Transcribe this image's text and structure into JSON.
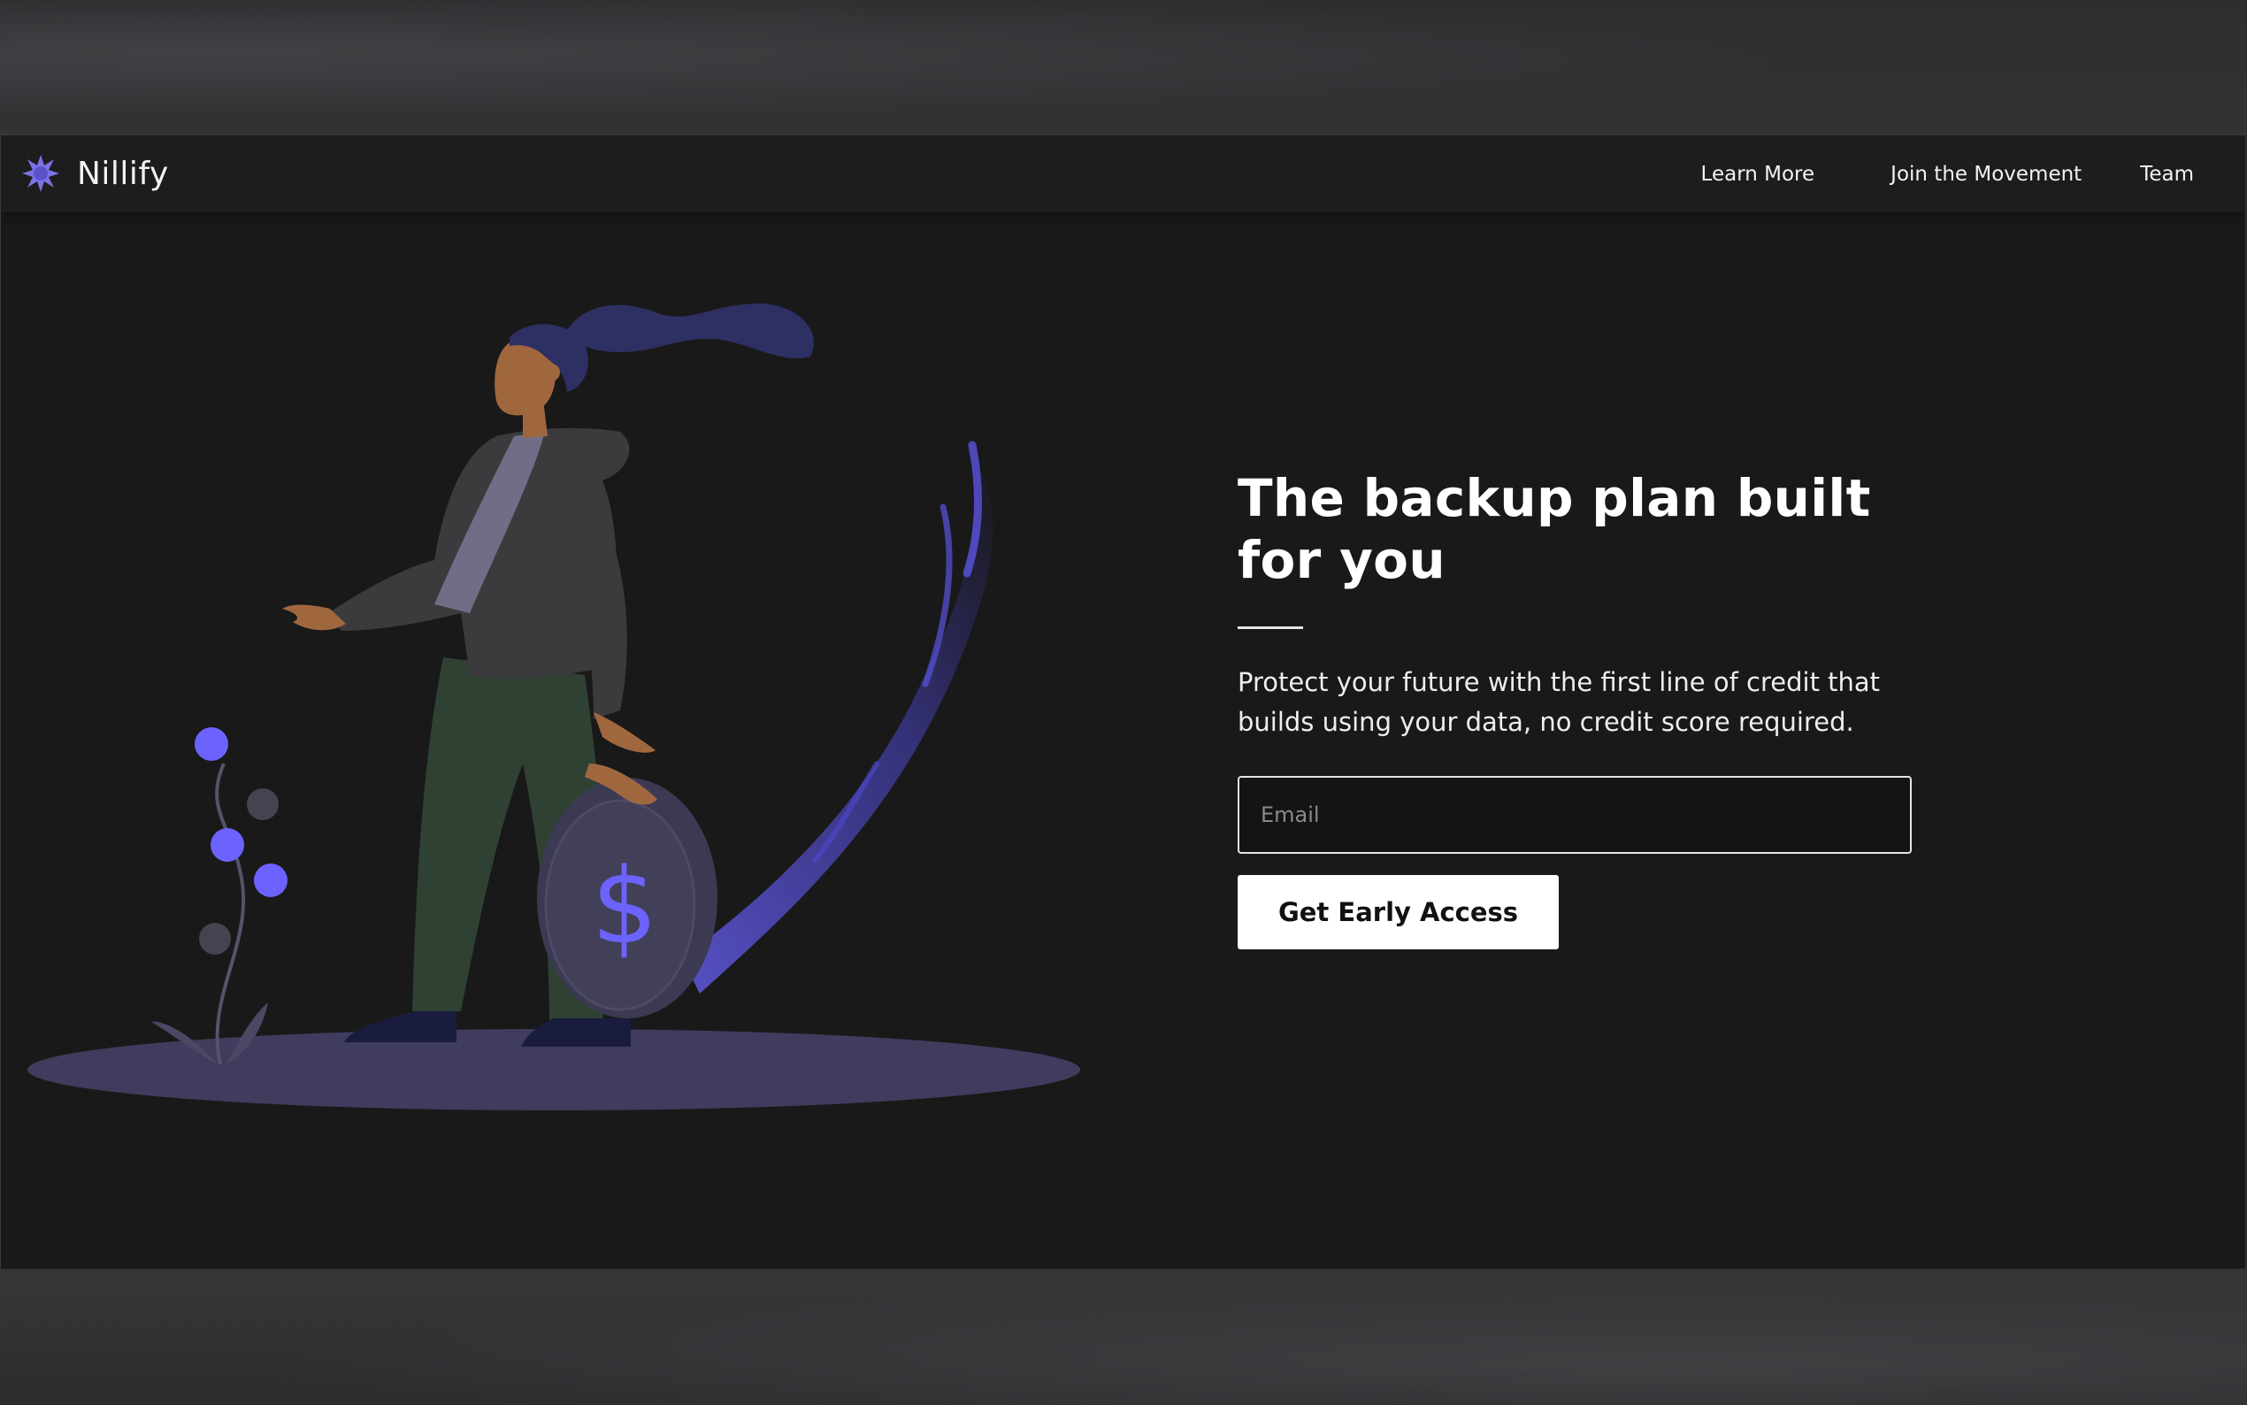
{
  "brand": {
    "name": "Nillify",
    "logo_icon": "star-burst-logo-icon"
  },
  "nav": {
    "links": [
      {
        "label": "Learn More"
      },
      {
        "label": "Join the Movement"
      },
      {
        "label": "Team"
      }
    ]
  },
  "hero": {
    "title": "The backup plan built for you",
    "subtitle": "Protect your future with the first line of credit that builds using your data, no credit score required.",
    "email_placeholder": "Email",
    "email_value": "",
    "cta_label": "Get Early Access"
  },
  "illustration": {
    "coin_symbol": "$"
  },
  "colors": {
    "page_bg": "#191919",
    "nav_bg": "#1d1d1e",
    "accent": "#6c63ff",
    "text": "#ffffff",
    "button_bg": "#ffffff",
    "button_text": "#111111"
  }
}
